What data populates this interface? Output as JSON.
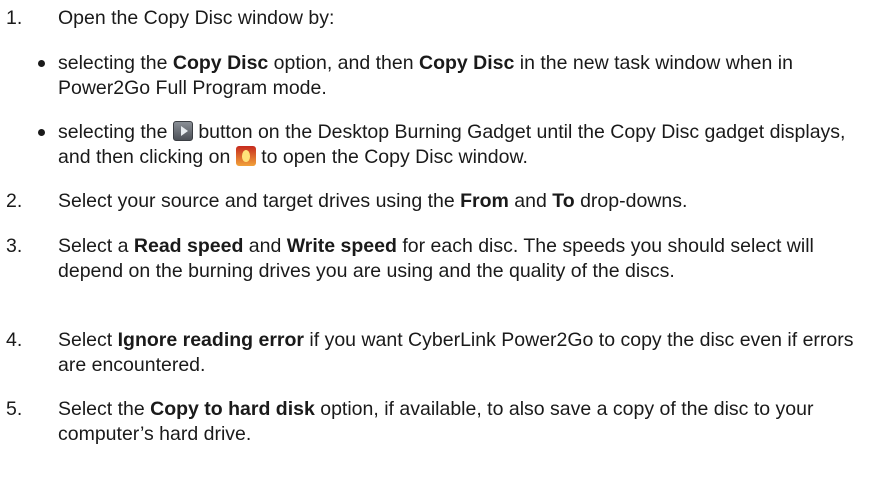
{
  "steps": [
    {
      "num": "1.",
      "parts": [
        "Open the Copy Disc window by:"
      ]
    },
    {
      "num": "2.",
      "parts": [
        "Select your source and target drives using the ",
        "From",
        " and ",
        "To",
        " drop-downs."
      ]
    },
    {
      "num": "3.",
      "parts": [
        "Select a ",
        "Read speed",
        " and ",
        "Write speed",
        " for each disc. The speeds you should select will depend on the burning drives you are using and the quality of the discs."
      ]
    },
    {
      "num": "4.",
      "parts": [
        "Select ",
        "Ignore reading error",
        " if you want CyberLink Power2Go to copy the disc even if errors are encountered."
      ]
    },
    {
      "num": "5.",
      "parts": [
        "Select the ",
        "Copy to hard disk",
        " option, if available, to also save a copy of the disc to your computer’s hard drive."
      ]
    }
  ],
  "bullets": [
    {
      "parts": [
        "selecting the ",
        "Copy Disc",
        " option, and then ",
        "Copy Disc",
        " in the new task window when in Power2Go Full Program mode."
      ]
    },
    {
      "parts": [
        "selecting the ",
        " button on the Desktop Burning Gadget until the Copy Disc gadget displays, and then clicking on ",
        " to open the Copy Disc window."
      ],
      "icons": [
        "play-arrow-icon",
        "flame-icon"
      ]
    }
  ]
}
